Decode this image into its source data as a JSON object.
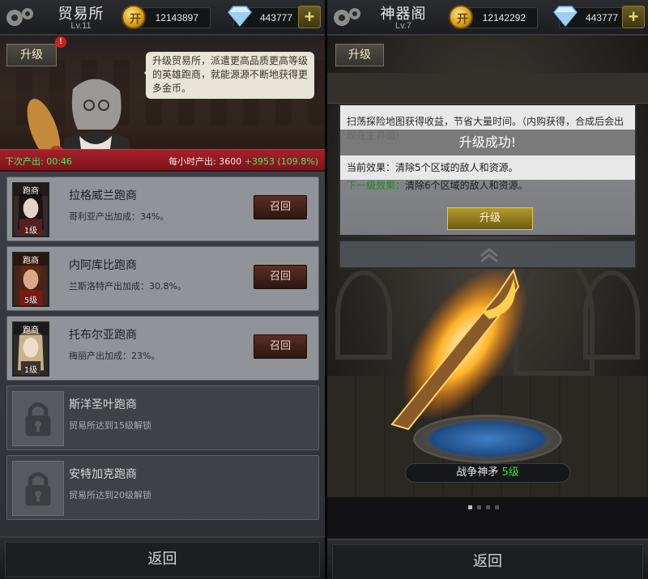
{
  "left": {
    "title": "贸易所",
    "level": "Lv.11",
    "gold": "12143897",
    "diamonds": "443777",
    "upgrade_label": "升级",
    "alert_badge": "!",
    "speech": "升级贸易所，派遣更高品质更高等级的英雄跑商，就能源源不断地获得更多金币。",
    "next_output_label": "下次产出: 00:46",
    "hourly_output": "每小时产出: 3600",
    "hourly_bonus": "+3953 (109.8%)",
    "merchants": [
      {
        "tag": "跑商",
        "level": "1级",
        "name": "拉格威兰跑商",
        "desc": "哥利亚产出加成：34%。",
        "button": "召回",
        "locked": false
      },
      {
        "tag": "跑商",
        "level": "5级",
        "name": "内阿库比跑商",
        "desc": "兰斯洛特产出加成：30.8%。",
        "button": "召回",
        "locked": false
      },
      {
        "tag": "跑商",
        "level": "1级",
        "name": "托布尔亚跑商",
        "desc": "梅丽产出加成：23%。",
        "button": "召回",
        "locked": false
      },
      {
        "name": "斯洋圣叶跑商",
        "desc": "贸易所达到15级解锁",
        "locked": true
      },
      {
        "name": "安特加克跑商",
        "desc": "贸易所达到20级解锁",
        "locked": true
      }
    ],
    "back_label": "返回"
  },
  "right": {
    "title": "神器阁",
    "level": "Lv.7",
    "gold": "12142292",
    "diamonds": "443777",
    "upgrade_label": "升级",
    "description": "扫荡探险地图获得收益，节省大量时间。（内购获得，合成后会出现在主界面）",
    "success_text": "升级成功!",
    "current_effect_label": "当前效果：",
    "current_effect": "清除5个区域的敌人和资源。",
    "next_effect_label": "下一级效果：",
    "next_effect": "清除6个区域的敌人和资源。",
    "upgrade_button": "升级",
    "weapon_name": "战争神矛",
    "weapon_level": "5级",
    "back_label": "返回"
  },
  "colors": {
    "output_green": "#3ef05e",
    "banner_red": "#a8202a",
    "gold_button": "#b49a2e"
  }
}
